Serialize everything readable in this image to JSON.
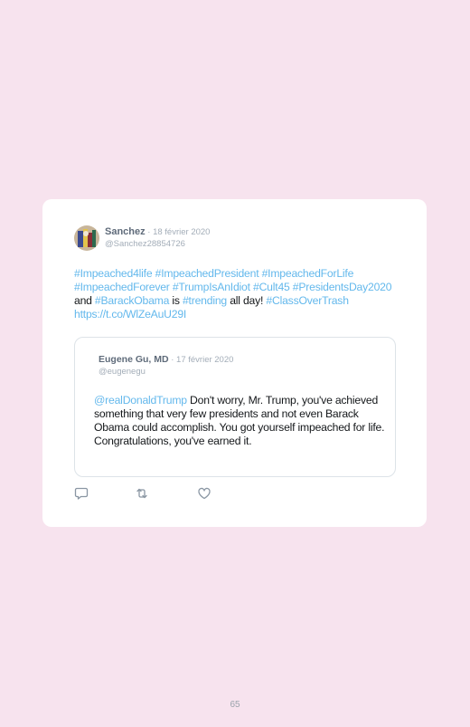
{
  "tweet": {
    "author_name": "Sanchez",
    "date": " · 18 février 2020",
    "handle": "@Sanchez28854726",
    "text_segments": [
      {
        "t": "#Impeached4life #ImpeachedPresident #ImpeachedForLife #ImpeachedForever #TrumpIsAnIdiot #Cult45 #PresidentsDay2020",
        "link": true
      },
      {
        "t": " and ",
        "link": false
      },
      {
        "t": "#BarackObama",
        "link": true
      },
      {
        "t": " is ",
        "link": false
      },
      {
        "t": "#trending",
        "link": true
      },
      {
        "t": " all day! ",
        "link": false
      },
      {
        "t": "#ClassOverTrash https://t.co/WlZeAuU29I",
        "link": true
      }
    ]
  },
  "quoted": {
    "author_name": "Eugene Gu, MD",
    "date": " · 17 février 2020",
    "handle": "@eugenegu",
    "mention": "@realDonaldTrump",
    "body": " Don't worry, Mr. Trump, you've achieved something that very few presidents and not even Barack Obama could accomplish. You got yourself impeached for life. Congratulations, you've earned it."
  },
  "actions": {
    "icons": [
      "reply-icon",
      "retweet-icon",
      "like-icon"
    ]
  },
  "page_number": "65",
  "colors": {
    "background": "#f7e3ee",
    "link": "#63b8ec",
    "card": "#ffffff"
  }
}
